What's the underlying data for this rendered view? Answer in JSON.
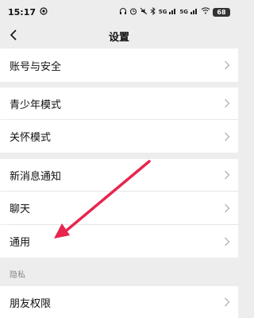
{
  "status_bar": {
    "time": "15:17",
    "right_indicators": [
      "headphones-icon",
      "alarm-icon",
      "mute-icon",
      "bluetooth-icon",
      "signal-icon",
      "signal-icon",
      "wifi-icon"
    ],
    "net_label_1": "5G",
    "net_label_2": "5G",
    "battery": "68"
  },
  "nav": {
    "title": "设置",
    "back_icon": "chevron-left-icon"
  },
  "groups": [
    {
      "items": [
        {
          "label": "账号与安全"
        }
      ]
    },
    {
      "items": [
        {
          "label": "青少年模式"
        },
        {
          "label": "关怀模式"
        }
      ]
    },
    {
      "items": [
        {
          "label": "新消息通知"
        },
        {
          "label": "聊天"
        },
        {
          "label": "通用"
        }
      ]
    }
  ],
  "privacy": {
    "header": "隐私",
    "items": [
      {
        "label": "朋友权限"
      }
    ]
  },
  "annotation": {
    "arrow_color": "#e8254f",
    "arrow_target": "通用"
  },
  "colors": {
    "background": "#ededed",
    "row_background": "#ffffff",
    "chevron": "#b2b2b2"
  }
}
